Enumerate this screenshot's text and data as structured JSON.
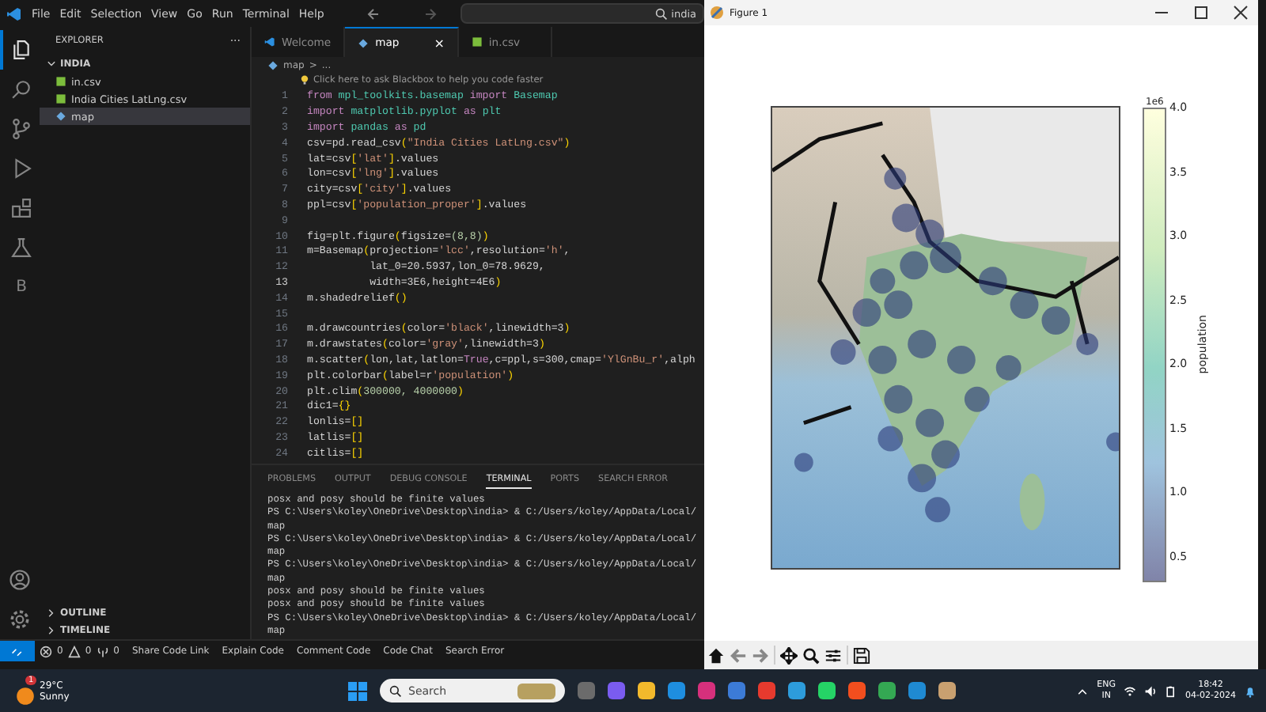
{
  "menu": [
    "File",
    "Edit",
    "Selection",
    "View",
    "Go",
    "Run",
    "Terminal",
    "Help"
  ],
  "search": {
    "value": "india"
  },
  "sidebar": {
    "title": "EXPLORER",
    "more": "···",
    "folder": "INDIA",
    "expanded": true,
    "files": [
      {
        "name": "in.csv",
        "kind": "csv",
        "selected": false
      },
      {
        "name": "India Cities LatLng.csv",
        "kind": "csv",
        "selected": false
      },
      {
        "name": "map",
        "kind": "py",
        "selected": true
      }
    ],
    "sections": [
      "OUTLINE",
      "TIMELINE"
    ]
  },
  "activity": [
    {
      "kind": "files",
      "selected": true
    },
    {
      "kind": "search",
      "selected": false
    },
    {
      "kind": "git",
      "selected": false
    },
    {
      "kind": "run",
      "selected": false
    },
    {
      "kind": "ext",
      "selected": false
    },
    {
      "kind": "flask",
      "selected": false
    },
    {
      "kind": "letter",
      "label": "B",
      "selected": false
    }
  ],
  "tabs": [
    {
      "label": "Welcome",
      "kind": "vscode",
      "selected": false
    },
    {
      "label": "map",
      "kind": "py",
      "selected": true
    },
    {
      "label": "in.csv",
      "kind": "csv",
      "selected": false
    }
  ],
  "close_glyph": "×",
  "breadcrumb": [
    "map",
    ">",
    "..."
  ],
  "hint": "Click here to ask Blackbox to help you code faster",
  "code": [
    {
      "n": "1",
      "current": false,
      "t": [
        {
          "text": "from",
          "kind": "k"
        },
        {
          "text": " mpl_toolkits.basemap ",
          "kind": "m"
        },
        {
          "text": "import",
          "kind": "k"
        },
        {
          "text": " Basemap",
          "kind": "m"
        }
      ]
    },
    {
      "n": "2",
      "current": false,
      "t": [
        {
          "text": "import",
          "kind": "k"
        },
        {
          "text": " matplotlib.pyplot ",
          "kind": "m"
        },
        {
          "text": "as",
          "kind": "k"
        },
        {
          "text": " plt",
          "kind": "m"
        }
      ]
    },
    {
      "n": "3",
      "current": false,
      "t": [
        {
          "text": "import",
          "kind": "k"
        },
        {
          "text": " pandas ",
          "kind": "m"
        },
        {
          "text": "as",
          "kind": "k"
        },
        {
          "text": " pd",
          "kind": "m"
        }
      ]
    },
    {
      "n": "4",
      "current": false,
      "t": [
        {
          "text": "csv=pd.read_csv",
          "kind": "p"
        },
        {
          "text": "(",
          "kind": "b"
        },
        {
          "text": "\"India Cities LatLng.csv\"",
          "kind": "s"
        },
        {
          "text": ")",
          "kind": "b"
        }
      ]
    },
    {
      "n": "5",
      "current": false,
      "t": [
        {
          "text": "lat=csv",
          "kind": "p"
        },
        {
          "text": "[",
          "kind": "b"
        },
        {
          "text": "'lat'",
          "kind": "s"
        },
        {
          "text": "]",
          "kind": "b"
        },
        {
          "text": ".values",
          "kind": "p"
        }
      ]
    },
    {
      "n": "6",
      "current": false,
      "t": [
        {
          "text": "lon=csv",
          "kind": "p"
        },
        {
          "text": "[",
          "kind": "b"
        },
        {
          "text": "'lng'",
          "kind": "s"
        },
        {
          "text": "]",
          "kind": "b"
        },
        {
          "text": ".values",
          "kind": "p"
        }
      ]
    },
    {
      "n": "7",
      "current": false,
      "t": [
        {
          "text": "city=csv",
          "kind": "p"
        },
        {
          "text": "[",
          "kind": "b"
        },
        {
          "text": "'city'",
          "kind": "s"
        },
        {
          "text": "]",
          "kind": "b"
        },
        {
          "text": ".values",
          "kind": "p"
        }
      ]
    },
    {
      "n": "8",
      "current": false,
      "t": [
        {
          "text": "ppl=csv",
          "kind": "p"
        },
        {
          "text": "[",
          "kind": "b"
        },
        {
          "text": "'population_proper'",
          "kind": "s"
        },
        {
          "text": "]",
          "kind": "b"
        },
        {
          "text": ".values",
          "kind": "p"
        }
      ]
    },
    {
      "n": "9",
      "current": false
    },
    {
      "n": "10",
      "current": false,
      "t": [
        {
          "text": "fig=plt.figure",
          "kind": "p"
        },
        {
          "text": "(",
          "kind": "b"
        },
        {
          "text": "figsize=",
          "kind": "p"
        },
        {
          "text": "(8,8)",
          "kind": "n"
        },
        {
          "text": ")",
          "kind": "b"
        }
      ]
    },
    {
      "n": "11",
      "current": false,
      "t": [
        {
          "text": "m=Basemap",
          "kind": "p"
        },
        {
          "text": "(",
          "kind": "b"
        },
        {
          "text": "projection=",
          "kind": "p"
        },
        {
          "text": "'lcc'",
          "kind": "s"
        },
        {
          "text": ",resolution=",
          "kind": "p"
        },
        {
          "text": "'h'",
          "kind": "s"
        },
        {
          "text": ",",
          "kind": "p"
        }
      ]
    },
    {
      "n": "12",
      "current": false,
      "t": [
        {
          "text": "          lat_0=20.5937,lon_0=78.9629,",
          "kind": "p"
        }
      ]
    },
    {
      "n": "13",
      "current": true,
      "t": [
        {
          "text": "          width=3E6,height=4E6",
          "kind": "p"
        },
        {
          "text": ")",
          "kind": "b"
        }
      ]
    },
    {
      "n": "14",
      "current": false,
      "t": [
        {
          "text": "m.shadedrelief",
          "kind": "p"
        },
        {
          "text": "()",
          "kind": "b"
        }
      ]
    },
    {
      "n": "15",
      "current": false
    },
    {
      "n": "16",
      "current": false,
      "t": [
        {
          "text": "m.drawcountries",
          "kind": "p"
        },
        {
          "text": "(",
          "kind": "b"
        },
        {
          "text": "color=",
          "kind": "p"
        },
        {
          "text": "'black'",
          "kind": "s"
        },
        {
          "text": ",linewidth=3",
          "kind": "p"
        },
        {
          "text": ")",
          "kind": "b"
        }
      ]
    },
    {
      "n": "17",
      "current": false,
      "t": [
        {
          "text": "m.drawstates",
          "kind": "p"
        },
        {
          "text": "(",
          "kind": "b"
        },
        {
          "text": "color=",
          "kind": "p"
        },
        {
          "text": "'gray'",
          "kind": "s"
        },
        {
          "text": ",linewidth=3",
          "kind": "p"
        },
        {
          "text": ")",
          "kind": "b"
        }
      ]
    },
    {
      "n": "18",
      "current": false,
      "t": [
        {
          "text": "m.scatter",
          "kind": "p"
        },
        {
          "text": "(",
          "kind": "b"
        },
        {
          "text": "lon,lat,latlon=",
          "kind": "p"
        },
        {
          "text": "True",
          "kind": "k"
        },
        {
          "text": ",c=ppl,s=300,cmap=",
          "kind": "p"
        },
        {
          "text": "'YlGnBu_r'",
          "kind": "s"
        },
        {
          "text": ",alph",
          "kind": "p"
        }
      ]
    },
    {
      "n": "19",
      "current": false,
      "t": [
        {
          "text": "plt.colorbar",
          "kind": "p"
        },
        {
          "text": "(",
          "kind": "b"
        },
        {
          "text": "label=r",
          "kind": "p"
        },
        {
          "text": "'population'",
          "kind": "s"
        },
        {
          "text": ")",
          "kind": "b"
        }
      ]
    },
    {
      "n": "20",
      "current": false,
      "t": [
        {
          "text": "plt.clim",
          "kind": "p"
        },
        {
          "text": "(",
          "kind": "b"
        },
        {
          "text": "300000, 4000000",
          "kind": "n"
        },
        {
          "text": ")",
          "kind": "b"
        }
      ]
    },
    {
      "n": "21",
      "current": false,
      "t": [
        {
          "text": "dic1=",
          "kind": "p"
        },
        {
          "text": "{}",
          "kind": "b"
        }
      ]
    },
    {
      "n": "22",
      "current": false,
      "t": [
        {
          "text": "lonlis=",
          "kind": "p"
        },
        {
          "text": "[]",
          "kind": "b"
        }
      ]
    },
    {
      "n": "23",
      "current": false,
      "t": [
        {
          "text": "latlis=",
          "kind": "p"
        },
        {
          "text": "[]",
          "kind": "b"
        }
      ]
    },
    {
      "n": "24",
      "current": false,
      "t": [
        {
          "text": "citlis=",
          "kind": "p"
        },
        {
          "text": "[]",
          "kind": "b"
        }
      ]
    }
  ],
  "panel_tabs": [
    {
      "label": "PROBLEMS",
      "selected": false
    },
    {
      "label": "OUTPUT",
      "selected": false
    },
    {
      "label": "DEBUG CONSOLE",
      "selected": false
    },
    {
      "label": "TERMINAL",
      "selected": true
    },
    {
      "label": "PORTS",
      "selected": false
    },
    {
      "label": "SEARCH ERROR",
      "selected": false
    }
  ],
  "terminal": [
    "posx and posy should be finite values",
    "PS C:\\Users\\koley\\OneDrive\\Desktop\\india> & C:/Users/koley/AppData/Local/",
    "map",
    "PS C:\\Users\\koley\\OneDrive\\Desktop\\india> & C:/Users/koley/AppData/Local/",
    "map",
    "PS C:\\Users\\koley\\OneDrive\\Desktop\\india> & C:/Users/koley/AppData/Local/",
    "map",
    "posx and posy should be finite values",
    "posx and posy should be finite values",
    "PS C:\\Users\\koley\\OneDrive\\Desktop\\india> & C:/Users/koley/AppData/Local/",
    "map"
  ],
  "status_bar": {
    "errors": "0",
    "warnings": "0",
    "ports": "0",
    "items": [
      "Share Code Link",
      "Explain Code",
      "Comment Code",
      "Code Chat",
      "Search Error"
    ]
  },
  "figure": {
    "title": "Figure 1",
    "colorbar": {
      "exponent": "1e6",
      "label": "population",
      "ticks": [
        "4.0",
        "3.5",
        "3.0",
        "2.5",
        "2.0",
        "1.5",
        "1.0",
        "0.5"
      ]
    },
    "toolbar": [
      {
        "kind": "home"
      },
      {
        "kind": "back"
      },
      {
        "kind": "forward"
      },
      {
        "kind": "pan"
      },
      {
        "kind": "zoom"
      },
      {
        "kind": "configure"
      },
      {
        "kind": "save"
      }
    ]
  },
  "taskbar": {
    "weather": {
      "temp": "29°C",
      "text": "Sunny",
      "badge": "1"
    },
    "search_placeholder": "Search",
    "apps": [
      {
        "color": "#6b6b6b"
      },
      {
        "color": "#7a5cf0"
      },
      {
        "color": "#f2b92c"
      },
      {
        "color": "#1e8ee0"
      },
      {
        "color": "#d6307c"
      },
      {
        "color": "#3c7bd6"
      },
      {
        "color": "#e63a2e"
      },
      {
        "color": "#2d9cdb"
      },
      {
        "color": "#25d366"
      },
      {
        "color": "#f24e1e"
      },
      {
        "color": "#34a853"
      },
      {
        "color": "#1f8ad2"
      },
      {
        "color": "#c8a070"
      }
    ],
    "lang": "ENG",
    "region": "IN",
    "time": "18:42",
    "date": "04-02-2024"
  }
}
